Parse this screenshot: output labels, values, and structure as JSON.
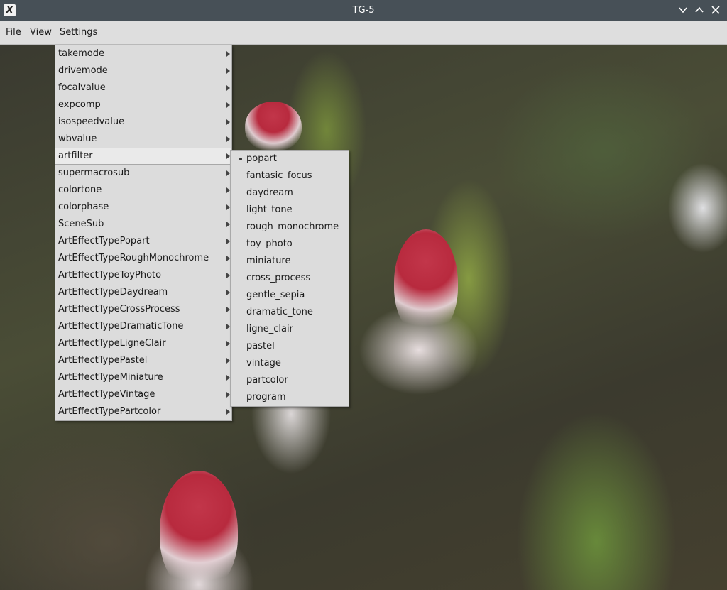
{
  "window": {
    "title": "TG-5",
    "app_icon": "x-app-icon",
    "controls": [
      "minimize-icon",
      "maximize-icon",
      "close-icon"
    ]
  },
  "menubar": {
    "items": [
      {
        "label": "File"
      },
      {
        "label": "View"
      },
      {
        "label": "Settings"
      }
    ]
  },
  "settings_menu": {
    "items": [
      {
        "label": "takemode"
      },
      {
        "label": "drivemode"
      },
      {
        "label": "focalvalue"
      },
      {
        "label": "expcomp"
      },
      {
        "label": "isospeedvalue"
      },
      {
        "label": "wbvalue"
      },
      {
        "label": "artfilter"
      },
      {
        "label": "supermacrosub"
      },
      {
        "label": "colortone"
      },
      {
        "label": "colorphase"
      },
      {
        "label": "SceneSub"
      },
      {
        "label": "ArtEffectTypePopart"
      },
      {
        "label": "ArtEffectTypeRoughMonochrome"
      },
      {
        "label": "ArtEffectTypeToyPhoto"
      },
      {
        "label": "ArtEffectTypeDaydream"
      },
      {
        "label": "ArtEffectTypeCrossProcess"
      },
      {
        "label": "ArtEffectTypeDramaticTone"
      },
      {
        "label": "ArtEffectTypeLigneClair"
      },
      {
        "label": "ArtEffectTypePastel"
      },
      {
        "label": "ArtEffectTypeMiniature"
      },
      {
        "label": "ArtEffectTypeVintage"
      },
      {
        "label": "ArtEffectTypePartcolor"
      }
    ],
    "active": "artfilter"
  },
  "artfilter_submenu": {
    "selected": "popart",
    "items": [
      {
        "label": "popart"
      },
      {
        "label": "fantasic_focus"
      },
      {
        "label": "daydream"
      },
      {
        "label": "light_tone"
      },
      {
        "label": "rough_monochrome"
      },
      {
        "label": "toy_photo"
      },
      {
        "label": "miniature"
      },
      {
        "label": "cross_process"
      },
      {
        "label": "gentle_sepia"
      },
      {
        "label": "dramatic_tone"
      },
      {
        "label": "ligne_clair"
      },
      {
        "label": "pastel"
      },
      {
        "label": "vintage"
      },
      {
        "label": "partcolor"
      },
      {
        "label": "program"
      }
    ]
  },
  "colors": {
    "titlebar": "#475057",
    "menubar": "#dedede",
    "menu_bg": "#dcdcdc",
    "menu_active": "#eaeaea"
  }
}
